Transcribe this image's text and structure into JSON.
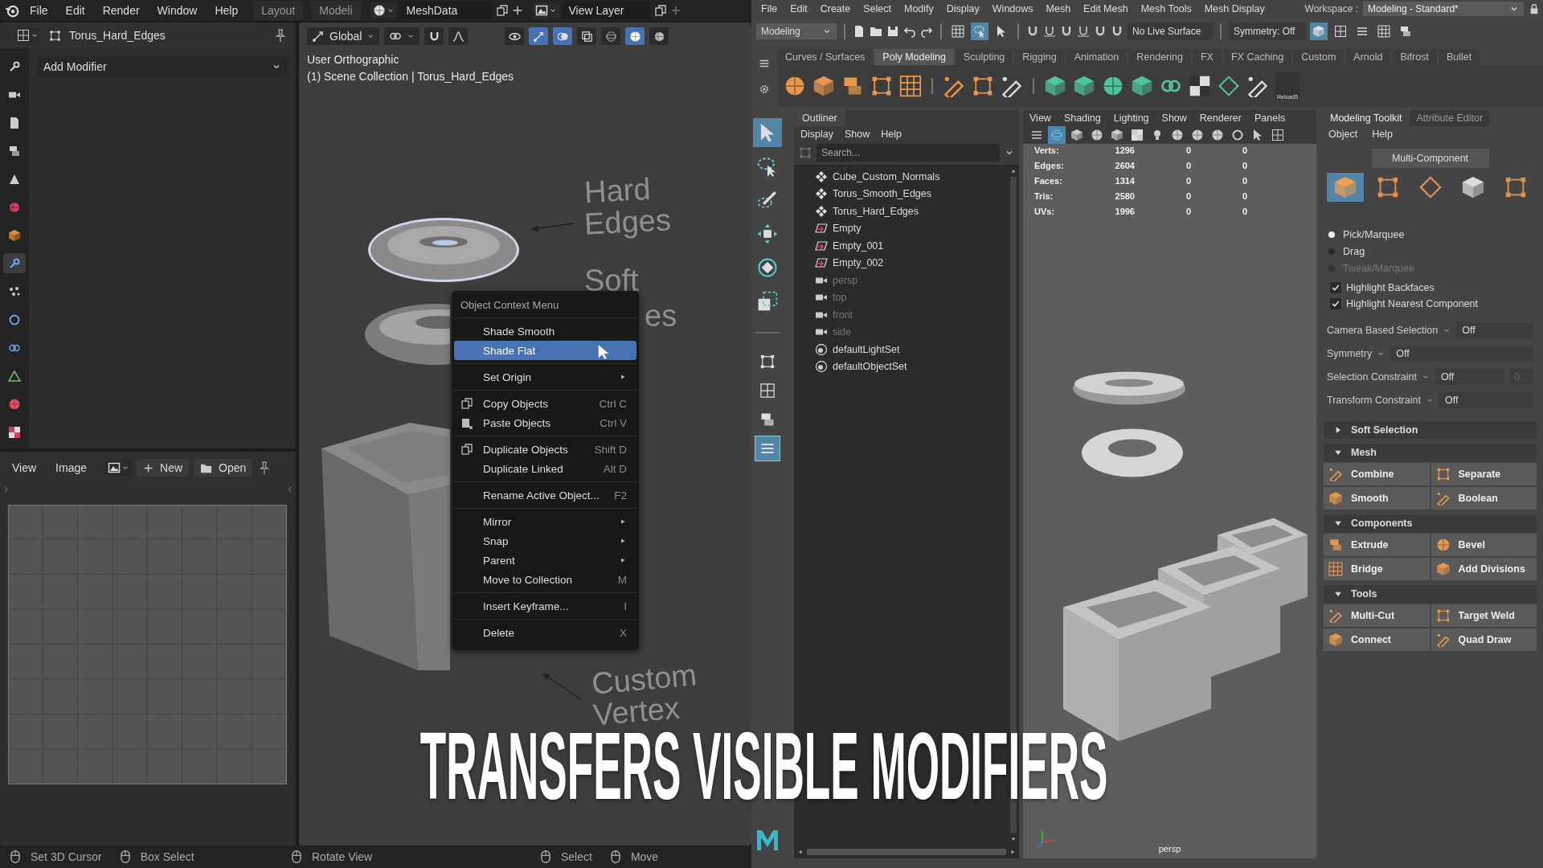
{
  "blender": {
    "menu": [
      "File",
      "Edit",
      "Render",
      "Window",
      "Help"
    ],
    "workspace_tabs": [
      {
        "label": "Layout",
        "selected": false
      },
      {
        "label": "Modeli",
        "selected": false
      }
    ],
    "scene_field": "MeshData",
    "view_layer_field": "View Layer",
    "property_tabs": [
      {
        "kind": "tool",
        "selected": false
      },
      {
        "kind": "render",
        "selected": false
      },
      {
        "kind": "output",
        "selected": false
      },
      {
        "kind": "view-layer",
        "selected": false
      },
      {
        "kind": "scene",
        "selected": false
      },
      {
        "kind": "world",
        "selected": false
      },
      {
        "kind": "object",
        "selected": false
      },
      {
        "kind": "modifier",
        "selected": true
      },
      {
        "kind": "particles",
        "selected": false
      },
      {
        "kind": "physics",
        "selected": false
      },
      {
        "kind": "constraints",
        "selected": false
      },
      {
        "kind": "data",
        "selected": false
      },
      {
        "kind": "material",
        "selected": false
      },
      {
        "kind": "texture",
        "selected": false
      }
    ],
    "object_name": "Torus_Hard_Edges",
    "add_modifier": "Add Modifier",
    "viewport": {
      "orientation": "Global",
      "header_toggles": [
        {
          "kind": "snap",
          "on": false
        },
        {
          "kind": "proportional",
          "on": false
        },
        {
          "kind": "visibility",
          "on": false
        },
        {
          "kind": "gizmo",
          "on": true
        },
        {
          "kind": "overlay",
          "on": true
        },
        {
          "kind": "xray",
          "on": false
        }
      ],
      "shading_modes": [
        {
          "kind": "wireframe",
          "selected": false
        },
        {
          "kind": "solid",
          "selected": true
        },
        {
          "kind": "material",
          "selected": false
        }
      ],
      "view_name": "User Orthographic",
      "collection_line": "(1) Scene Collection | Torus_Hard_Edges",
      "scene_labels": [
        "Hard",
        "Edges",
        "Soft",
        "es",
        "Custom",
        "Vertex"
      ]
    },
    "context_menu": {
      "title": "Object Context Menu",
      "groups": [
        [
          {
            "label": "Shade Smooth",
            "kind": "plain",
            "selected": false,
            "submenu": false
          },
          {
            "label": "Shade Flat",
            "kind": "plain",
            "selected": true,
            "submenu": false
          }
        ],
        [
          {
            "label": "Set Origin",
            "kind": "plain",
            "selected": false,
            "submenu": true
          }
        ],
        [
          {
            "label": "Copy Objects",
            "shortcut": "Ctrl C",
            "kind": "copy",
            "selected": false,
            "submenu": false
          },
          {
            "label": "Paste Objects",
            "shortcut": "Ctrl V",
            "kind": "paste",
            "selected": false,
            "submenu": false
          }
        ],
        [
          {
            "label": "Duplicate Objects",
            "shortcut": "Shift D",
            "kind": "duplicate",
            "selected": false,
            "submenu": false
          },
          {
            "label": "Duplicate Linked",
            "shortcut": "Alt D",
            "kind": "plain",
            "selected": false,
            "submenu": false
          }
        ],
        [
          {
            "label": "Rename Active Object...",
            "shortcut": "F2",
            "kind": "plain",
            "selected": false,
            "submenu": false
          }
        ],
        [
          {
            "label": "Mirror",
            "kind": "plain",
            "selected": false,
            "submenu": true
          },
          {
            "label": "Snap",
            "kind": "plain",
            "selected": false,
            "submenu": true
          },
          {
            "label": "Parent",
            "kind": "plain",
            "selected": false,
            "submenu": true
          },
          {
            "label": "Move to Collection",
            "shortcut": "M",
            "kind": "plain",
            "selected": false,
            "submenu": false
          }
        ],
        [
          {
            "label": "Insert Keyframe...",
            "shortcut": "I",
            "kind": "plain",
            "selected": false,
            "submenu": false
          }
        ],
        [
          {
            "label": "Delete",
            "shortcut": "X",
            "kind": "plain",
            "selected": false,
            "submenu": false
          }
        ]
      ]
    },
    "image_editor": {
      "menu": [
        "View",
        "Image"
      ],
      "new_button": "New",
      "open_button": "Open"
    },
    "status_bar": [
      [
        "Set 3D Cursor",
        "Box Select"
      ],
      [
        "Rotate View"
      ],
      [
        "Select",
        "Move"
      ]
    ]
  },
  "maya": {
    "menu": [
      "File",
      "Edit",
      "Create",
      "Select",
      "Modify",
      "Display",
      "Windows",
      "Mesh",
      "Edit Mesh",
      "Mesh Tools",
      "Mesh Display"
    ],
    "workspace_label": "Workspace :",
    "workspace": "Modeling - Standard*",
    "menu_set": "Modeling",
    "select_modes": [
      {
        "selected": false
      },
      {
        "selected": true
      },
      {
        "selected": false
      }
    ],
    "live_surface": "No Live Surface",
    "symmetry": "Symmetry: Off",
    "panel_toggles": [
      {
        "selected": true
      },
      {
        "selected": false
      },
      {
        "selected": false
      },
      {
        "selected": false
      },
      {
        "selected": false
      }
    ],
    "shelf_tabs": [
      {
        "label": "Curves / Surfaces",
        "selected": false
      },
      {
        "label": "Poly Modeling",
        "selected": true
      },
      {
        "label": "Sculpting",
        "selected": false
      },
      {
        "label": "Rigging",
        "selected": false
      },
      {
        "label": "Animation",
        "selected": false
      },
      {
        "label": "Rendering",
        "selected": false
      },
      {
        "label": "FX",
        "selected": false
      },
      {
        "label": "FX Caching",
        "selected": false
      },
      {
        "label": "Custom",
        "selected": false
      },
      {
        "label": "Arnold",
        "selected": false
      },
      {
        "label": "Bifrost",
        "selected": false
      },
      {
        "label": "Bullet",
        "selected": false
      }
    ],
    "shelf_button_label": "Reload5",
    "tools": [
      {
        "kind": "select",
        "selected": true
      },
      {
        "kind": "lasso",
        "selected": false
      },
      {
        "kind": "paint",
        "selected": false
      },
      {
        "kind": "move",
        "selected": false
      },
      {
        "kind": "rotate",
        "selected": false
      },
      {
        "kind": "scale",
        "selected": false
      }
    ],
    "layouts": [
      {
        "kind": "single",
        "selected": false
      },
      {
        "kind": "quad",
        "selected": false
      },
      {
        "kind": "split",
        "selected": false
      },
      {
        "kind": "outliner",
        "selected": true
      }
    ],
    "outliner": {
      "title": "Outliner",
      "menu": [
        "Display",
        "Show",
        "Help"
      ],
      "search_placeholder": "Search...",
      "items": [
        {
          "label": "Cube_Custom_Normals",
          "kind": "mesh",
          "dimmed": false
        },
        {
          "label": "Torus_Smooth_Edges",
          "kind": "mesh",
          "dimmed": false
        },
        {
          "label": "Torus_Hard_Edges",
          "kind": "mesh",
          "dimmed": false
        },
        {
          "label": "Empty",
          "kind": "locator",
          "dimmed": false
        },
        {
          "label": "Empty_001",
          "kind": "locator",
          "dimmed": false
        },
        {
          "label": "Empty_002",
          "kind": "locator",
          "dimmed": false
        },
        {
          "label": "persp",
          "kind": "camera",
          "dimmed": true
        },
        {
          "label": "top",
          "kind": "camera",
          "dimmed": true
        },
        {
          "label": "front",
          "kind": "camera",
          "dimmed": true
        },
        {
          "label": "side",
          "kind": "camera",
          "dimmed": true
        },
        {
          "label": "defaultLightSet",
          "kind": "set",
          "dimmed": false
        },
        {
          "label": "defaultObjectSet",
          "kind": "set",
          "dimmed": false
        }
      ]
    },
    "viewport": {
      "menu": [
        "View",
        "Shading",
        "Lighting",
        "Show",
        "Renderer",
        "Panels"
      ],
      "icon_bar": [
        {
          "on": false
        },
        {
          "on": true
        },
        {
          "on": false
        },
        {
          "on": false
        },
        {
          "on": false
        },
        {
          "on": false
        },
        {
          "on": false
        },
        {
          "on": false
        },
        {
          "on": false
        },
        {
          "on": false
        },
        {
          "on": false
        },
        {
          "on": false
        },
        {
          "on": false
        }
      ],
      "stats": [
        {
          "label": "Verts:",
          "values": [
            "1296",
            "0",
            "0"
          ]
        },
        {
          "label": "Edges:",
          "values": [
            "2604",
            "0",
            "0"
          ]
        },
        {
          "label": "Faces:",
          "values": [
            "1314",
            "0",
            "0"
          ]
        },
        {
          "label": "Tris:",
          "values": [
            "2580",
            "0",
            "0"
          ]
        },
        {
          "label": "UVs:",
          "values": [
            "1996",
            "0",
            "0"
          ]
        }
      ],
      "camera": "persp"
    },
    "toolkit": {
      "tabs": [
        {
          "label": "Modeling Toolkit",
          "selected": true
        },
        {
          "label": "Attribute Editor",
          "selected": false
        }
      ],
      "menu": [
        "Object",
        "Help"
      ],
      "mode_button": "Multi-Component",
      "component_modes": [
        {
          "kind": "object",
          "selected": true
        },
        {
          "kind": "vertex",
          "selected": false
        },
        {
          "kind": "edge",
          "selected": false
        },
        {
          "kind": "face",
          "selected": false
        },
        {
          "kind": "uv",
          "selected": false
        }
      ],
      "pick_modes": [
        {
          "label": "Pick/Marquee",
          "selected": true,
          "disabled": false
        },
        {
          "label": "Drag",
          "selected": false,
          "disabled": false
        },
        {
          "label": "Tweak/Marquee",
          "selected": false,
          "disabled": true
        }
      ],
      "highlights": [
        {
          "label": "Highlight Backfaces",
          "checked": true
        },
        {
          "label": "Highlight Nearest Component",
          "checked": true
        }
      ],
      "options": [
        {
          "label": "Camera Based Selection",
          "value": "Off"
        },
        {
          "label": "Symmetry",
          "value": "Off"
        },
        {
          "label": "Selection Constraint",
          "value": "Off",
          "extra": "0"
        },
        {
          "label": "Transform Constraint",
          "value": "Off"
        }
      ],
      "sections": [
        {
          "title": "Soft Selection",
          "expanded": false
        },
        {
          "title": "Mesh",
          "expanded": true,
          "buttons": [
            "Combine",
            "Separate",
            "Smooth",
            "Boolean"
          ]
        },
        {
          "title": "Components",
          "expanded": true,
          "buttons": [
            "Extrude",
            "Bevel",
            "Bridge",
            "Add Divisions"
          ]
        },
        {
          "title": "Tools",
          "expanded": true,
          "buttons": [
            "Multi-Cut",
            "Target Weld",
            "Connect",
            "Quad Draw"
          ]
        }
      ]
    }
  },
  "caption": "TRANSFERS VISIBLE MODIFIERS"
}
